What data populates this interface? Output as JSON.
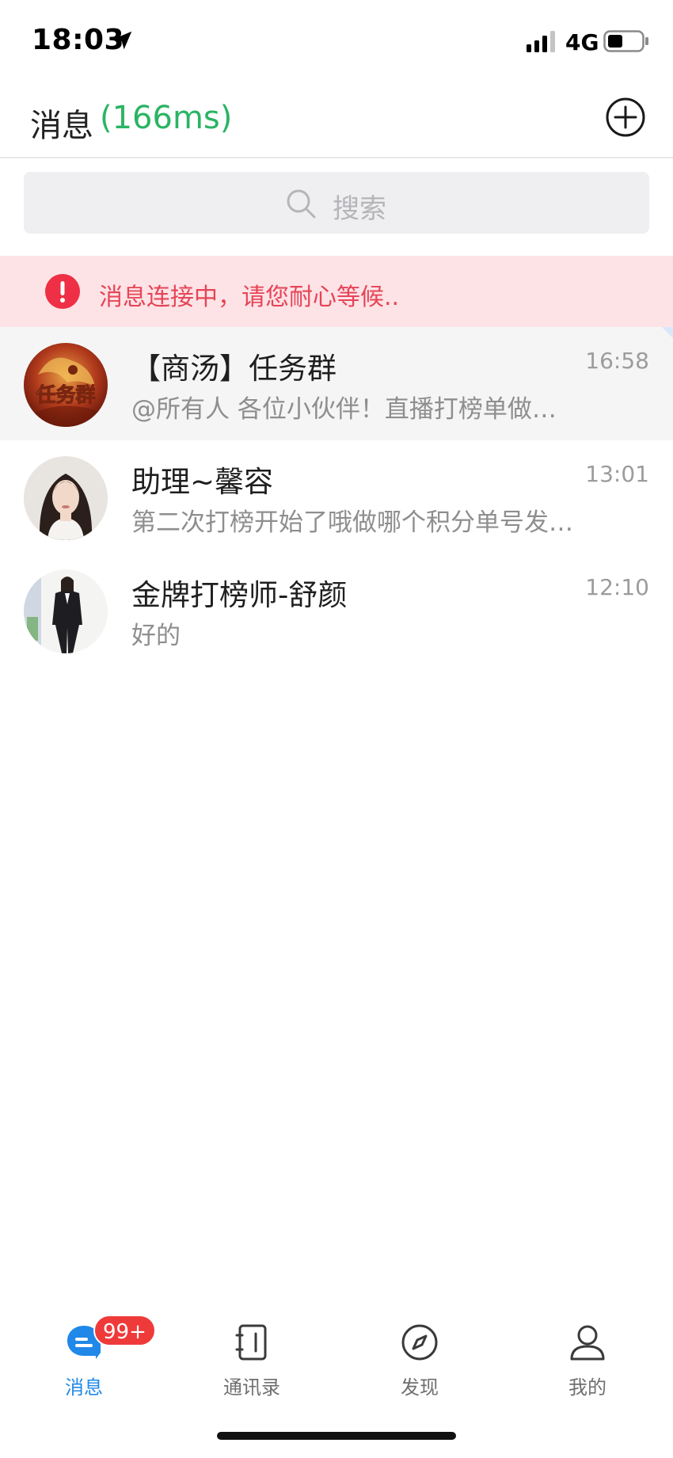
{
  "status_bar": {
    "time": "18:03",
    "network": "4G",
    "icons": [
      "location-arrow-icon",
      "signal-icon",
      "battery-icon"
    ]
  },
  "header": {
    "title": "消息",
    "latency": "(166ms)",
    "add_icon": "plus-circle-icon"
  },
  "search": {
    "placeholder": "搜索",
    "icon": "search-icon"
  },
  "banner": {
    "text": "消息连接中，请您耐心等候..",
    "icon": "alert-icon"
  },
  "conversations": [
    {
      "name": "【商汤】任务群",
      "time": "16:58",
      "preview": "@所有人 各位小伙伴！直播打榜单做…",
      "avatar_text": "任务群",
      "pinned": true
    },
    {
      "name": "助理~馨容",
      "time": "13:01",
      "preview": "第二次打榜开始了哦做哪个积分单号发…",
      "pinned": false
    },
    {
      "name": "金牌打榜师-舒颜",
      "time": "12:10",
      "preview": "好的",
      "pinned": false
    }
  ],
  "tabs": [
    {
      "label": "消息",
      "icon": "chat-bubble-icon",
      "active": true,
      "badge": "99+"
    },
    {
      "label": "通讯录",
      "icon": "address-book-icon",
      "active": false
    },
    {
      "label": "发现",
      "icon": "compass-icon",
      "active": false
    },
    {
      "label": "我的",
      "icon": "person-icon",
      "active": false
    }
  ],
  "colors": {
    "accent": "#1f88e8",
    "latency_green": "#2ab464",
    "banner_bg": "#fde3e6",
    "banner_text": "#e64457",
    "badge_red": "#ef3a3a"
  }
}
